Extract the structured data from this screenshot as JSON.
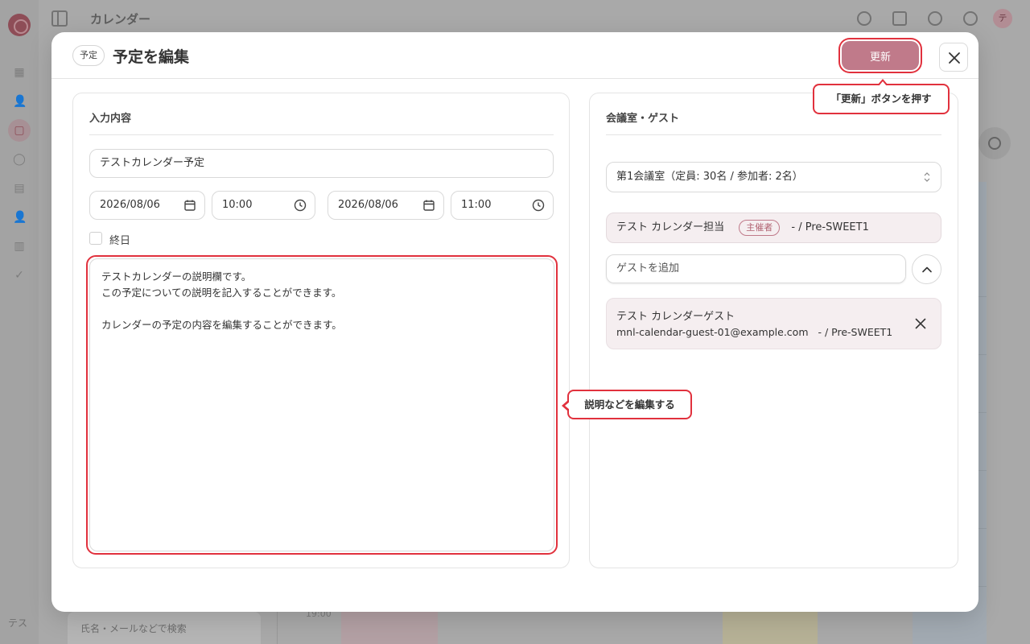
{
  "background": {
    "app_title": "カレンダー",
    "user_initial": "テ",
    "sidebar_bottom_label": "テス",
    "search_placeholder": "氏名・メールなどで検索",
    "time_label": "19:00"
  },
  "modal": {
    "badge": "予定",
    "title": "予定を編集",
    "update_label": "更新",
    "left_card": {
      "title": "入力内容",
      "event_title": "テストカレンダー予定",
      "start_date": "2026/08/06",
      "start_time": "10:00",
      "end_date": "2026/08/06",
      "end_time": "11:00",
      "all_day_label": "終日",
      "all_day_checked": false,
      "description": "テストカレンダーの説明欄です。\nこの予定についての説明を記入することができます。\n\nカレンダーの予定の内容を編集することができます。"
    },
    "right_card": {
      "title": "会議室・ゲスト",
      "room_selected": "第1会議室（定員: 30名 / 参加者: 2名）",
      "organizer_name": "テスト カレンダー担当",
      "organizer_tag": "主催者",
      "organizer_org": "- / Pre-SWEET1",
      "guest_placeholder": "ゲストを追加",
      "guest": {
        "name": "テスト カレンダーゲスト",
        "email": "mnl-calendar-guest-01@example.com",
        "org": "- / Pre-SWEET1"
      }
    }
  },
  "callouts": {
    "update": "「更新」ボタンを押す",
    "description": "説明などを編集する"
  },
  "colors": {
    "accent": "#c07a8a",
    "highlight": "#e1313d",
    "chip_bg": "#f5eef0",
    "overlay": "#a9a9a9"
  }
}
